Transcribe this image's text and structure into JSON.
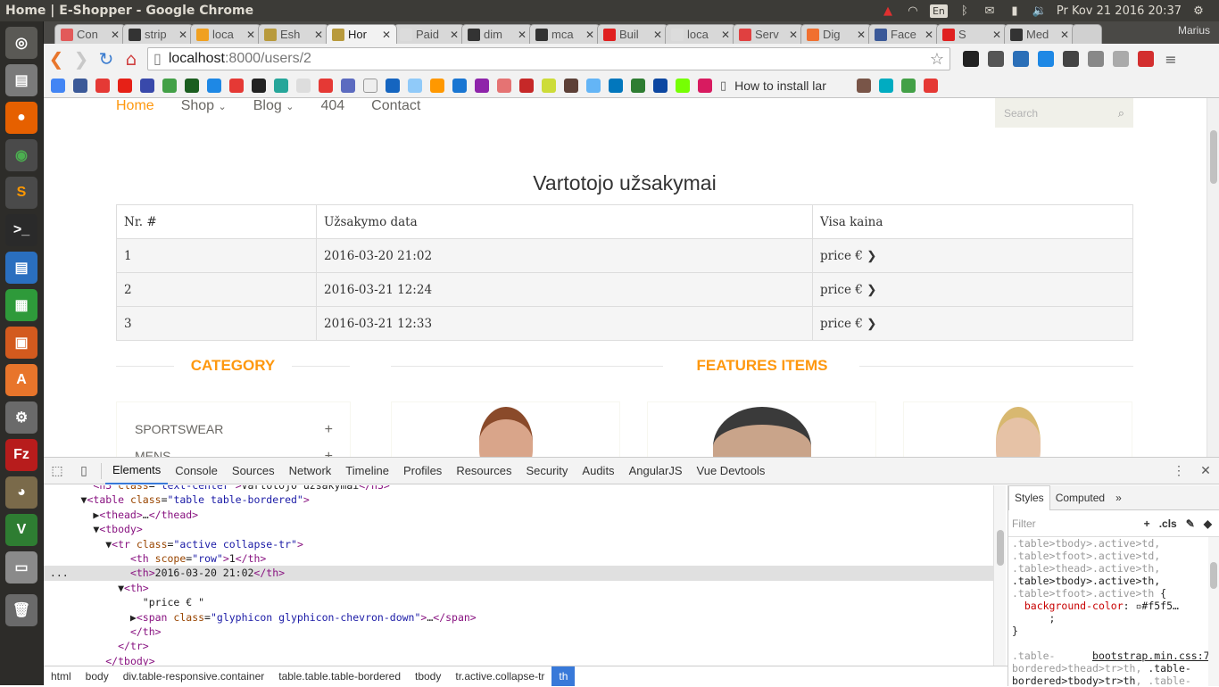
{
  "os": {
    "window_title": "Home | E-Shopper - Google Chrome",
    "keyboard_layout": "En",
    "clock": "Pr Kov 21 2016 20:37",
    "launcher_icons": [
      "ubuntu-dash-icon",
      "files-icon",
      "firefox-icon",
      "chrome-icon",
      "sublime-text-icon",
      "terminal-icon",
      "writer-icon",
      "calc-icon",
      "impress-icon",
      "software-center-icon",
      "system-settings-icon",
      "filezilla-icon",
      "gimp-icon",
      "vim-icon",
      "drive-icon",
      "trash-icon"
    ]
  },
  "browser": {
    "tabs": [
      {
        "label": "Con",
        "color": "#e25a5a"
      },
      {
        "label": "strip",
        "color": "#333333"
      },
      {
        "label": "loca",
        "color": "#f0a020"
      },
      {
        "label": "Esh",
        "color": "#b89a3c"
      },
      {
        "label": "Hor",
        "color": "#b89a3c",
        "active": true
      },
      {
        "label": "Paid",
        "color": "#dcdcdc"
      },
      {
        "label": "dim",
        "color": "#333333"
      },
      {
        "label": "mca",
        "color": "#333333"
      },
      {
        "label": "Buil",
        "color": "#e02020"
      },
      {
        "label": "loca",
        "color": "#dcdcdc"
      },
      {
        "label": "Serv",
        "color": "#e04040"
      },
      {
        "label": "Dig",
        "color": "#f07030"
      },
      {
        "label": "Face",
        "color": "#3b5998"
      },
      {
        "label": "S",
        "color": "#e02020"
      },
      {
        "label": "Med",
        "color": "#333333"
      }
    ],
    "profile_name": "Marius",
    "url_host": "localhost",
    "url_path": ":8000/users/2",
    "bookmark_text": "How to install lar"
  },
  "site": {
    "nav": [
      "Home",
      "Shop",
      "Blog",
      "404",
      "Contact"
    ],
    "search_placeholder": "Search",
    "page_title": "Vartotojo užsakymai",
    "table": {
      "headers": [
        "Nr. #",
        "Užsakymo data",
        "Visa kaina"
      ],
      "rows": [
        [
          "1",
          "2016-03-20 21:02",
          "price € ❯"
        ],
        [
          "2",
          "2016-03-21 12:24",
          "price € ❯"
        ],
        [
          "3",
          "2016-03-21 12:33",
          "price € ❯"
        ]
      ]
    },
    "category_title": "CATEGORY",
    "features_title": "FEATURES ITEMS",
    "categories": [
      "SPORTSWEAR",
      "MENS"
    ]
  },
  "devtools": {
    "tabs": [
      "Elements",
      "Console",
      "Sources",
      "Network",
      "Timeline",
      "Profiles",
      "Resources",
      "Security",
      "Audits",
      "AngularJS",
      "Vue Devtools"
    ],
    "breadcrumbs": [
      "html",
      "body",
      "div.table-responsive.container",
      "table.table.table-bordered",
      "tbody",
      "tr.active.collapse-tr",
      "th"
    ],
    "styles_tabs": [
      "Styles",
      "Computed"
    ],
    "filter_placeholder": "Filter",
    "filter_tools": [
      "+",
      ".cls"
    ],
    "css_link": "bootstrap.min.css:7"
  }
}
